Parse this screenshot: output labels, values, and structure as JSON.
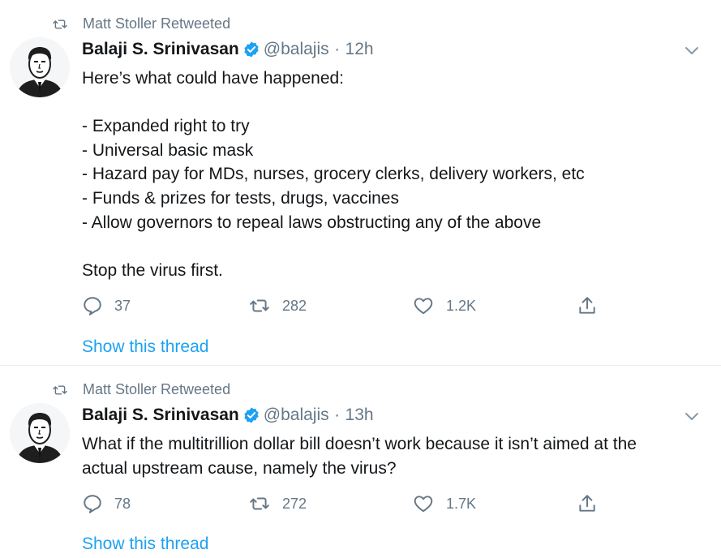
{
  "colors": {
    "accent": "#1da1f2",
    "secondary_text": "#657786",
    "divider": "#e6ecf0"
  },
  "tweets": [
    {
      "retweet_label": "Matt Stoller Retweeted",
      "name": "Balaji S. Srinivasan",
      "handle": "@balajis",
      "separator": "·",
      "time": "12h",
      "lines": [
        "Here’s what could have happened:",
        "",
        "- Expanded right to try",
        "- Universal basic mask",
        "- Hazard pay for MDs, nurses, grocery clerks, delivery workers, etc",
        "- Funds & prizes for tests, drugs, vaccines",
        "- Allow governors to repeal laws obstructing any of the above",
        "",
        "Stop the virus first."
      ],
      "replies": "37",
      "retweets": "282",
      "likes": "1.2K",
      "show_thread": "Show this thread",
      "icons": [
        "retweet-icon",
        "verified-badge-icon",
        "chevron-down-icon",
        "reply-icon",
        "retweet-icon",
        "heart-icon",
        "share-icon"
      ]
    },
    {
      "retweet_label": "Matt Stoller Retweeted",
      "name": "Balaji S. Srinivasan",
      "handle": "@balajis",
      "separator": "·",
      "time": "13h",
      "lines": [
        "What if the multitrillion dollar bill doesn’t work because it isn’t aimed at the",
        "actual upstream cause, namely the virus?"
      ],
      "replies": "78",
      "retweets": "272",
      "likes": "1.7K",
      "show_thread": "Show this thread",
      "icons": [
        "retweet-icon",
        "verified-badge-icon",
        "chevron-down-icon",
        "reply-icon",
        "retweet-icon",
        "heart-icon",
        "share-icon"
      ]
    }
  ]
}
